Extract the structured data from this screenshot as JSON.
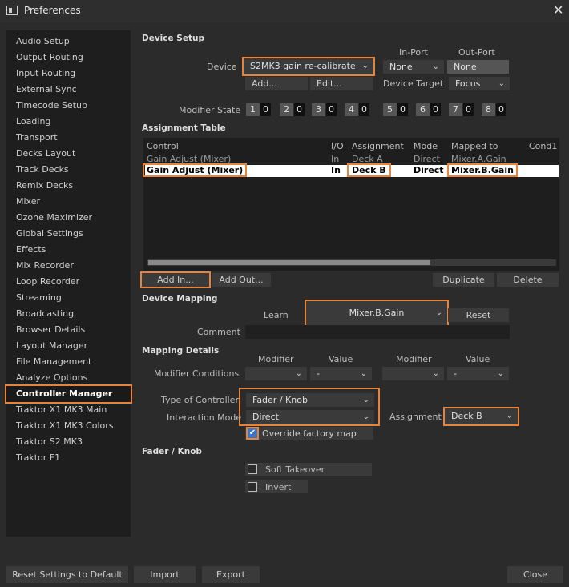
{
  "window": {
    "title": "Preferences",
    "close": "✕"
  },
  "sidebar": {
    "items": [
      {
        "label": "Audio Setup"
      },
      {
        "label": "Output Routing"
      },
      {
        "label": "Input Routing"
      },
      {
        "label": "External Sync"
      },
      {
        "label": "Timecode Setup"
      },
      {
        "label": "Loading"
      },
      {
        "label": "Transport"
      },
      {
        "label": "Decks Layout"
      },
      {
        "label": "Track Decks"
      },
      {
        "label": "Remix Decks"
      },
      {
        "label": "Mixer"
      },
      {
        "label": "Ozone Maximizer"
      },
      {
        "label": "Global Settings"
      },
      {
        "label": "Effects"
      },
      {
        "label": "Mix Recorder"
      },
      {
        "label": "Loop Recorder"
      },
      {
        "label": "Streaming"
      },
      {
        "label": "Broadcasting"
      },
      {
        "label": "Browser Details"
      },
      {
        "label": "Layout Manager"
      },
      {
        "label": "File Management"
      },
      {
        "label": "Analyze Options"
      },
      {
        "label": "Controller Manager",
        "selected": true
      },
      {
        "label": "Traktor X1 MK3 Main"
      },
      {
        "label": "Traktor X1 MK3 Colors"
      },
      {
        "label": "Traktor S2 MK3"
      },
      {
        "label": "Traktor F1"
      }
    ]
  },
  "device_setup": {
    "heading": "Device Setup",
    "device_label": "Device",
    "device_value": "S2MK3 gain re-calibrate",
    "in_port_label": "In-Port",
    "in_port_value": "None",
    "out_port_label": "Out-Port",
    "out_port_value": "None",
    "add_button": "Add...",
    "edit_button": "Edit...",
    "device_target_label": "Device Target",
    "device_target_value": "Focus",
    "modifier_state_label": "Modifier State",
    "modifiers": [
      {
        "num": "1",
        "val": "0"
      },
      {
        "num": "2",
        "val": "0"
      },
      {
        "num": "3",
        "val": "0"
      },
      {
        "num": "4",
        "val": "0"
      },
      {
        "num": "5",
        "val": "0"
      },
      {
        "num": "6",
        "val": "0"
      },
      {
        "num": "7",
        "val": "0"
      },
      {
        "num": "8",
        "val": "0"
      }
    ]
  },
  "assignment_table": {
    "heading": "Assignment Table",
    "columns": [
      "Control",
      "I/O",
      "Assignment",
      "Mode",
      "Mapped to",
      "Cond1"
    ],
    "rows": [
      {
        "control": "Gain Adjust (Mixer)",
        "io": "In",
        "assignment": "Deck A",
        "mode": "Direct",
        "mapped": "Mixer.A.Gain"
      },
      {
        "control": "Gain Adjust (Mixer)",
        "io": "In",
        "assignment": "Deck B",
        "mode": "Direct",
        "mapped": "Mixer.B.Gain"
      }
    ],
    "add_in": "Add In...",
    "add_out": "Add Out...",
    "duplicate": "Duplicate",
    "delete": "Delete"
  },
  "device_mapping": {
    "heading": "Device Mapping",
    "learn_label": "Learn",
    "learn_value": "Mixer.B.Gain",
    "reset": "Reset",
    "comment_label": "Comment"
  },
  "mapping_details": {
    "heading": "Mapping Details",
    "modifier_col1": "Modifier",
    "value_col1": "Value",
    "modifier_col2": "Modifier",
    "value_col2": "Value",
    "modifier_conditions_label": "Modifier Conditions",
    "cond1_value": "-",
    "cond2_value": "-",
    "type_label": "Type of Controller",
    "type_value": "Fader / Knob",
    "interaction_label": "Interaction Mode",
    "interaction_value": "Direct",
    "assignment_label": "Assignment",
    "assignment_value": "Deck B",
    "override_label": "Override factory map",
    "override_checked": "✔"
  },
  "fader_knob": {
    "heading": "Fader / Knob",
    "soft_takeover": "Soft Takeover",
    "invert": "Invert"
  },
  "footer": {
    "reset": "Reset Settings to Default",
    "import": "Import",
    "export": "Export",
    "close": "Close"
  },
  "colors": {
    "highlight": "#e8833a",
    "selected_check": "#3b76c6"
  }
}
